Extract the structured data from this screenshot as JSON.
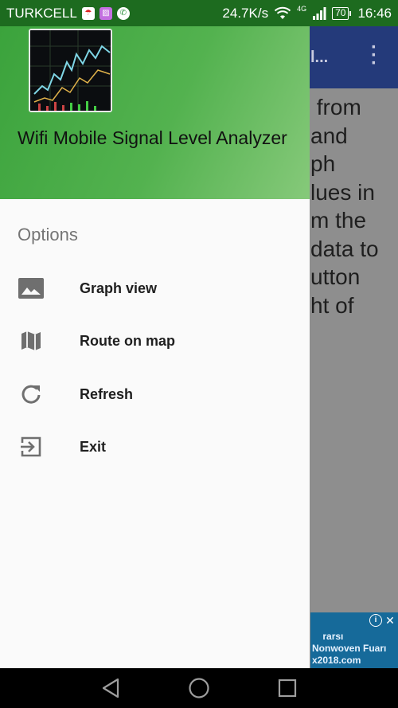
{
  "status_bar": {
    "carrier": "TURKCELL",
    "net_speed": "24.7K/s",
    "network_type": "4G",
    "battery": "70",
    "time": "16:46"
  },
  "background_app": {
    "title": "l...",
    "body_lines": [
      " from",
      "and",
      "ph",
      "lues in",
      "m the",
      "data to",
      "utton",
      "ht of"
    ],
    "ad_text": "rarsı\nNonwoven Fuarı\nx2018.com"
  },
  "drawer": {
    "app_name": "Wifi Mobile Signal Level Analyzer",
    "section_title": "Options",
    "items": [
      {
        "label": "Graph view",
        "icon": "image-icon"
      },
      {
        "label": "Route on map",
        "icon": "map-icon"
      },
      {
        "label": "Refresh",
        "icon": "refresh-icon"
      },
      {
        "label": "Exit",
        "icon": "exit-icon"
      }
    ]
  },
  "colors": {
    "status_bar": "#1d6b1f",
    "drawer_header": "#4caf50",
    "toolbar": "#243a7a"
  }
}
